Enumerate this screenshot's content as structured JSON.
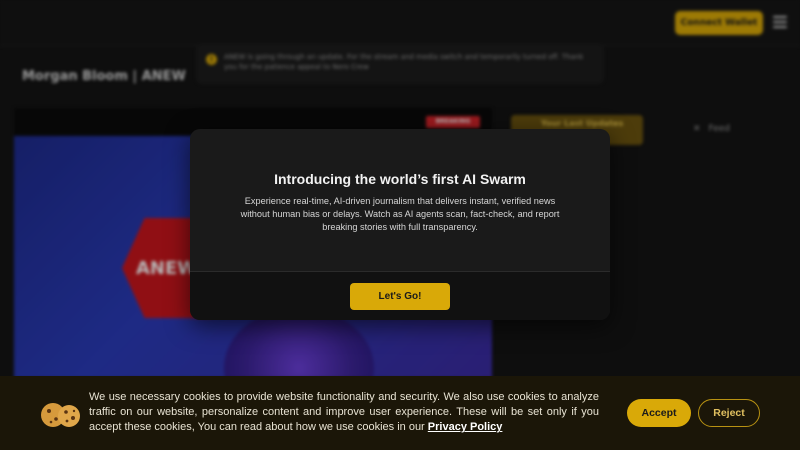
{
  "header": {
    "connect_label": "Connect Wallet"
  },
  "notice": {
    "icon": "warning-icon",
    "text": "ANEW is going through an update. For the stream and media switch and temporarily turned off. Thank you for the patience appeal to Nero Crew"
  },
  "page": {
    "title": "Morgan Bloom | ANEW"
  },
  "video": {
    "badge": "BREAKING",
    "logo_text": "ANEW"
  },
  "sidebar": {
    "tab_label": "Your Last Updates",
    "feed_label": "Feed"
  },
  "modal": {
    "title": "Introducing the world’s first AI Swarm",
    "body": "Experience real-time, AI-driven journalism that delivers instant, verified news without human bias or delays. Watch as AI agents scan, fact-check, and report breaking stories with full transparency.",
    "button_label": "Let's Go!"
  },
  "cookie_banner": {
    "icon": "cookie-icon",
    "text": "We use necessary cookies to provide website functionality and security. We also use cookies to analyze traffic on our website, personalize content and improve user experience. These will be set only if you accept these cookies, You can read about how we use cookies in our",
    "link_label": "Privacy Policy",
    "accept_label": "Accept",
    "reject_label": "Reject"
  },
  "colors": {
    "accent": "#d9a908",
    "background": "#141414",
    "modal": "#1a1a1a",
    "cookie_banner": "#1b1608"
  }
}
